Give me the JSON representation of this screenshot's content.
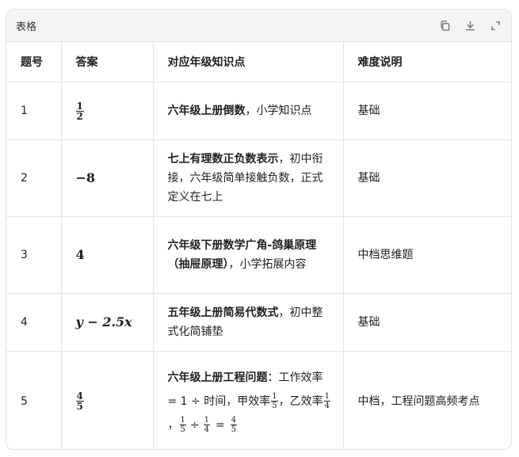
{
  "card": {
    "title": "表格",
    "icons": [
      "copy-icon",
      "download-icon",
      "expand-icon"
    ]
  },
  "table": {
    "headers": [
      "题号",
      "答案",
      "对应年级知识点",
      "难度说明"
    ],
    "rows": [
      {
        "num": "1",
        "answer": {
          "n": "1",
          "d": "2"
        },
        "topic_bold": "六年级上册倒数",
        "topic_rest": "，小学知识点",
        "difficulty": "基础"
      },
      {
        "num": "2",
        "answer_text": "−8",
        "topic_bold": "七上有理数正负数表示",
        "topic_rest": "，初中衔接，六年级简单接触负数，正式定义在七上",
        "difficulty": "基础"
      },
      {
        "num": "3",
        "answer_text": "4",
        "topic_bold": "六年级下册数学广角-鸽巢原理（抽屉原理）",
        "topic_rest": "，小学拓展内容",
        "difficulty": "中档思维题"
      },
      {
        "num": "4",
        "answer_text": "y − 2.5x",
        "topic_bold": "五年级上册简易代数式",
        "topic_rest": "，初中整式化简铺垫",
        "difficulty": "基础"
      },
      {
        "num": "5",
        "answer": {
          "n": "4",
          "d": "5"
        },
        "topic_bold": "六年级上册工程问题",
        "topic_part1": "：工作效率 = 1 ÷ 时间，甲效率",
        "f1": {
          "n": "1",
          "d": "5"
        },
        "topic_part2": "，乙效率",
        "f2": {
          "n": "1",
          "d": "4"
        },
        "topic_part3": "，",
        "f3": {
          "n": "1",
          "d": "5"
        },
        "op1": "÷",
        "f4": {
          "n": "1",
          "d": "4"
        },
        "op2": "=",
        "f5": {
          "n": "4",
          "d": "5"
        },
        "difficulty": "中档，工程问题高频考点"
      }
    ]
  }
}
